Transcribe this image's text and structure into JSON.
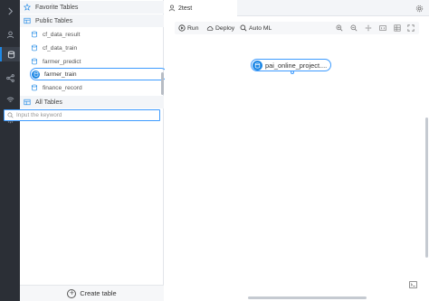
{
  "left_panel": {
    "favorite_header": "Favorite Tables",
    "public_header": "Public Tables",
    "public_tables": [
      {
        "label": "cf_data_result"
      },
      {
        "label": "cf_data_train"
      },
      {
        "label": "farmer_predict"
      },
      {
        "label": "farmer_train",
        "selected": true
      },
      {
        "label": "finance_record"
      }
    ],
    "all_header": "All Tables",
    "search_placeholder": "Input the keyword",
    "create_label": "Create table"
  },
  "tab": {
    "label": "2test"
  },
  "toolbar": {
    "run_label": "Run",
    "deploy_label": "Deploy",
    "automl_label": "Auto ML"
  },
  "canvas": {
    "node_label": "pai_online_project...."
  },
  "colors": {
    "accent": "#1e88e5",
    "rail": "#2b2f36"
  }
}
